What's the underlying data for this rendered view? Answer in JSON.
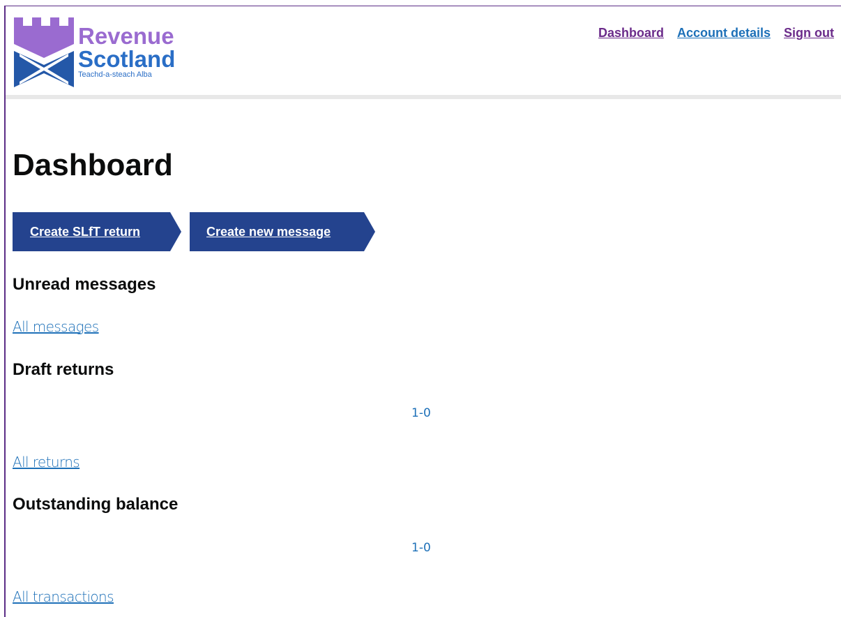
{
  "header": {
    "logo": {
      "word1": "Revenue",
      "word2": "Scotland",
      "subtitle": "Teachd-a-steach Alba",
      "colors": {
        "purple": "#9a6bd0",
        "blue": "#2a6ec6"
      }
    },
    "nav": [
      {
        "label": "Dashboard",
        "state": "visited"
      },
      {
        "label": "Account details",
        "state": "link"
      },
      {
        "label": "Sign out",
        "state": "visited"
      }
    ]
  },
  "main": {
    "title": "Dashboard",
    "actions": [
      {
        "label": "Create SLfT return"
      },
      {
        "label": "Create new message"
      }
    ],
    "sections": [
      {
        "title": "Unread messages",
        "link": "All messages"
      },
      {
        "title": "Draft returns",
        "pager": "1-0",
        "link": "All returns"
      },
      {
        "title": "Outstanding balance",
        "pager": "1-0",
        "link": "All transactions"
      }
    ]
  },
  "colors": {
    "button_bg": "#24438e",
    "link": "#1d70b8",
    "visited_link": "#6b2b8a",
    "frame": "#5b2d86"
  }
}
